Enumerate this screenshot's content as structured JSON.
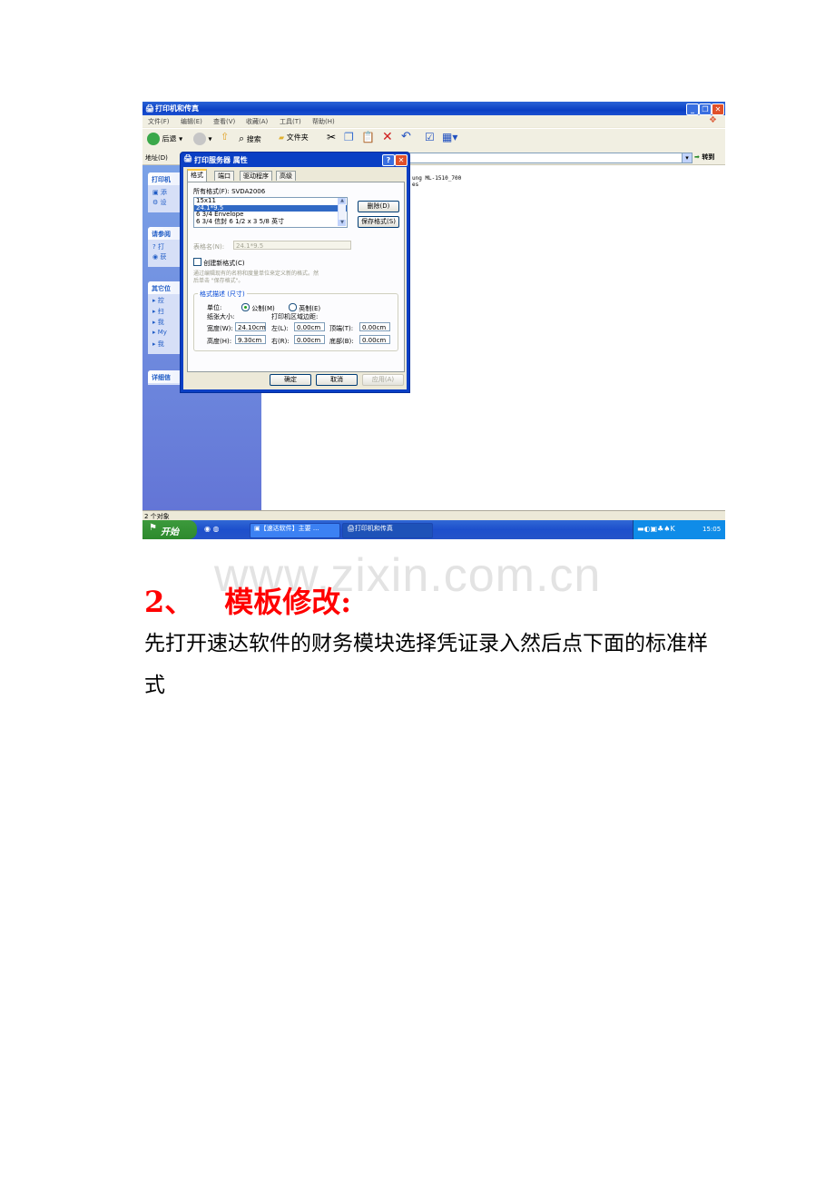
{
  "screenshot": {
    "window_title": "打印机和传真",
    "menu": [
      "文件(F)",
      "编辑(E)",
      "查看(V)",
      "收藏(A)",
      "工具(T)",
      "帮助(H)"
    ],
    "toolbar": {
      "back": "后退",
      "search": "搜索",
      "folders": "文件夹"
    },
    "address_label": "地址(D)",
    "go_label": "转到",
    "left_panels": [
      {
        "title": "打印机",
        "items": [
          "添",
          "设"
        ]
      },
      {
        "title": "请参阅",
        "items": [
          "打",
          "获"
        ]
      },
      {
        "title": "其它位",
        "items": [
          "控",
          "扫",
          "我",
          "My",
          "我"
        ]
      },
      {
        "title": "详细信",
        "items": []
      }
    ],
    "main_text": [
      "ung ML-1510_700",
      "es"
    ],
    "status": "2 个对象",
    "taskbar": {
      "start": "开始",
      "tasks": [
        "【速达软件】主要 ...",
        "打印机和传真"
      ],
      "clock": "15:05"
    },
    "dialog": {
      "title": "打印服务器 属性",
      "tabs": [
        "格式",
        "端口",
        "驱动程序",
        "高级"
      ],
      "forms_on_label": "所有格式(F): SVDA2006",
      "forms": [
        "15x11",
        "24.1*9.5",
        "6 3/4 Envelope",
        "6 3/4 信封 6 1/2 x 3 5/8 英寸"
      ],
      "selected_form": "24.1*9.5",
      "delete_button": "删除(D)",
      "save_form_button": "保存格式(S)",
      "form_name_label": "表格名(N):",
      "form_name_value": "24.1*9.5",
      "create_new_label": "创建新格式(C)",
      "hint_line1": "通过编辑现有的名称和度量单位来定义新的格式。然",
      "hint_line2": "后单击 \"保存格式\"。",
      "group_title": "格式描述 (尺寸)",
      "units_label": "单位:",
      "metric_label": "公制(M)",
      "english_label": "英制(E)",
      "paper_size_label": "纸张大小:",
      "margins_label": "打印机区域边距:",
      "width_label": "宽度(W):",
      "width_value": "24.10cm",
      "height_label": "高度(H):",
      "height_value": "9.30cm",
      "left_label": "左(L):",
      "left_value": "0.00cm",
      "right_label": "右(R):",
      "right_value": "0.00cm",
      "top_label": "顶端(T):",
      "top_value": "0.00cm",
      "bottom_label": "底部(B):",
      "bottom_value": "0.00cm",
      "ok_button": "确定",
      "cancel_button": "取消",
      "apply_button": "应用(A)"
    }
  },
  "watermark": "www.zixin.com.cn",
  "heading": {
    "number": "2、",
    "title": "模板修改:"
  },
  "paragraph": "先打开速达软件的财务模块选择凭证录入然后点下面的标准样式"
}
